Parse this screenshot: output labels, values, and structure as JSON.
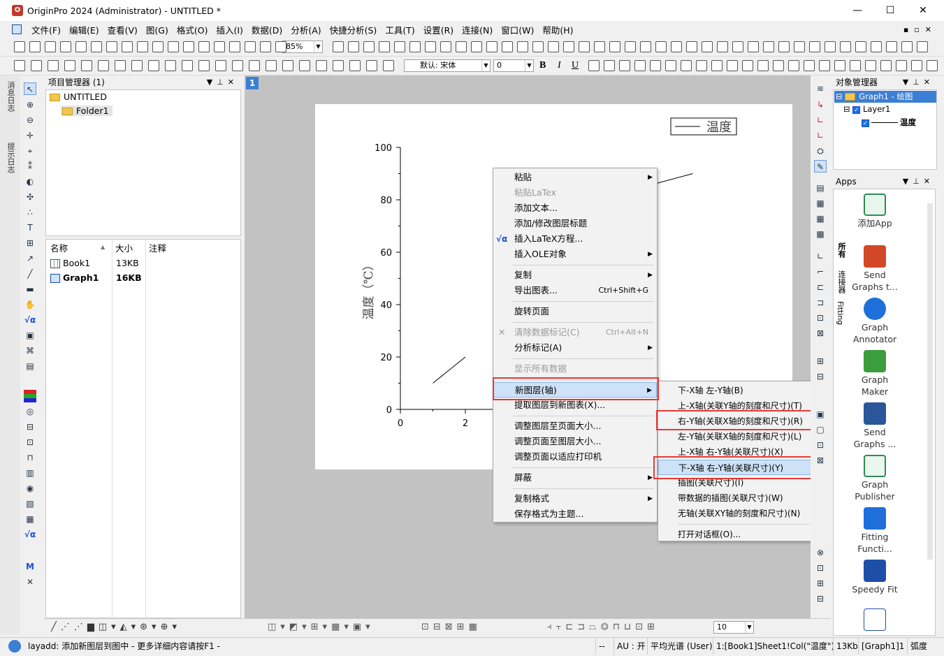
{
  "window": {
    "title": "OriginPro 2024 (Administrator) - UNTITLED *",
    "minimize": "—",
    "maximize": "☐",
    "close": "✕"
  },
  "menu": [
    "文件(F)",
    "编辑(E)",
    "查看(V)",
    "图(G)",
    "格式(O)",
    "插入(I)",
    "数据(D)",
    "分析(A)",
    "快捷分析(S)",
    "工具(T)",
    "设置(R)",
    "连接(N)",
    "窗口(W)",
    "帮助(H)"
  ],
  "toolbar": {
    "zoom": "85%",
    "font": "默认: 宋体",
    "size": "0",
    "linewidth": "10"
  },
  "sidetabs": [
    "消息日志",
    "提示日志"
  ],
  "project_manager": {
    "title": "项目管理器 (1)",
    "root": "UNTITLED",
    "folder": "Folder1",
    "columns": [
      "名称",
      "大小",
      "注释"
    ],
    "rows": [
      {
        "name": "Book1",
        "size": "13KB",
        "type": "workbook"
      },
      {
        "name": "Graph1",
        "size": "16KB",
        "type": "graph"
      }
    ]
  },
  "graph": {
    "page_number": "1",
    "ylabel": "温度（℃）",
    "legend": "温度"
  },
  "chart_data": {
    "type": "line",
    "ylabel": "温度（℃）",
    "xlabel": "",
    "legend": [
      "温度"
    ],
    "y_ticks": [
      "0",
      "20",
      "40",
      "60",
      "80",
      "100"
    ],
    "x_ticks": [
      "0",
      "2"
    ],
    "ylim": [
      0,
      100
    ],
    "series": [
      {
        "name": "温度",
        "x": [
          1,
          2
        ],
        "y": [
          10,
          20
        ]
      }
    ],
    "segment_upper_right": {
      "x": [
        7.8,
        9.0
      ],
      "y": [
        86,
        90
      ]
    }
  },
  "context_menu": {
    "items": [
      {
        "label": "粘贴",
        "sub": true
      },
      {
        "label": "粘贴LaTex",
        "disabled": true
      },
      {
        "label": "添加文本..."
      },
      {
        "label": "添加/修改图层标题"
      },
      {
        "label": "插入LaTeX方程...",
        "icon": "√α"
      },
      {
        "label": "插入OLE对象",
        "sub": true
      },
      {
        "sep": true
      },
      {
        "label": "复制",
        "sub": true
      },
      {
        "label": "导出图表...",
        "shortcut": "Ctrl+Shift+G"
      },
      {
        "sep": true
      },
      {
        "label": "旋转页面"
      },
      {
        "sep": true
      },
      {
        "label": "清除数据标记(C)",
        "shortcut": "Ctrl+Alt+N",
        "disabled": true
      },
      {
        "label": "分析标记(A)",
        "sub": true
      },
      {
        "sep": true
      },
      {
        "label": "显示所有数据",
        "disabled": true
      },
      {
        "sep": true
      },
      {
        "label": "新图层(轴)",
        "sub": true,
        "highlight": true
      },
      {
        "label": "提取图层到新图表(X)..."
      },
      {
        "sep": true
      },
      {
        "label": "调整图层至页面大小..."
      },
      {
        "label": "调整页面至图层大小..."
      },
      {
        "label": "调整页面以适应打印机"
      },
      {
        "sep": true
      },
      {
        "label": "屏蔽",
        "sub": true
      },
      {
        "sep": true
      },
      {
        "label": "复制格式",
        "sub": true
      },
      {
        "label": "保存格式为主题..."
      }
    ]
  },
  "submenu": {
    "items": [
      {
        "label": "下-X轴 左-Y轴(B)"
      },
      {
        "label": "上-X轴(关联Y轴的刻度和尺寸)(T)"
      },
      {
        "label": "右-Y轴(关联X轴的刻度和尺寸)(R)",
        "boxed": true
      },
      {
        "label": "左-Y轴(关联X轴的刻度和尺寸)(L)"
      },
      {
        "label": "上-X轴 右-Y轴(关联尺寸)(X)"
      },
      {
        "label": "下-X轴 右-Y轴(关联尺寸)(Y)",
        "highlight": true,
        "boxed": true
      },
      {
        "label": "插图(关联尺寸)(I)"
      },
      {
        "label": "带数据的插图(关联尺寸)(W)"
      },
      {
        "label": "无轴(关联XY轴的刻度和尺寸)(N)"
      },
      {
        "sep": true
      },
      {
        "label": "打开对话框(O)..."
      }
    ]
  },
  "object_manager": {
    "title": "对象管理器",
    "graph": "Graph1 - 绘图",
    "layer": "Layer1",
    "plot": "温度"
  },
  "apps": {
    "title": "Apps",
    "tabs": [
      "所有",
      "连接器",
      "Fitting"
    ],
    "items": [
      {
        "line1": "添加App",
        "line2": "",
        "icon": "add-app-icon",
        "color": "#2e8b57"
      },
      {
        "line1": "Send",
        "line2": "Graphs t...",
        "icon": "powerpoint-icon",
        "color": "#d24726"
      },
      {
        "line1": "Graph",
        "line2": "Annotator",
        "icon": "annotator-icon",
        "color": "#1e6fd9"
      },
      {
        "line1": "Graph",
        "line2": "Maker",
        "icon": "graph-maker-icon",
        "color": "#3c9d3c"
      },
      {
        "line1": "Send",
        "line2": "Graphs ...",
        "icon": "word-icon",
        "color": "#2b579a"
      },
      {
        "line1": "Graph",
        "line2": "Publisher",
        "icon": "publisher-icon",
        "color": "#2e8b57"
      },
      {
        "line1": "Fitting",
        "line2": "Functi...",
        "icon": "fitting-function-icon",
        "color": "#1e6fd9"
      },
      {
        "line1": "Speedy Fit",
        "line2": "",
        "icon": "speedy-fit-icon",
        "color": "#1e4fa8"
      }
    ]
  },
  "status": {
    "message": "layadd: 添加新图层到图中 - 更多详细内容请按F1 -",
    "dashes": "--",
    "au": "AU : 开",
    "smooth": "平均光谱 (User)",
    "ref": "1:[Book1]Sheet1!Col(\"温度\")[1:3]",
    "size": "13Kb",
    "graph": "[Graph1]1",
    "unit": "弧度"
  }
}
